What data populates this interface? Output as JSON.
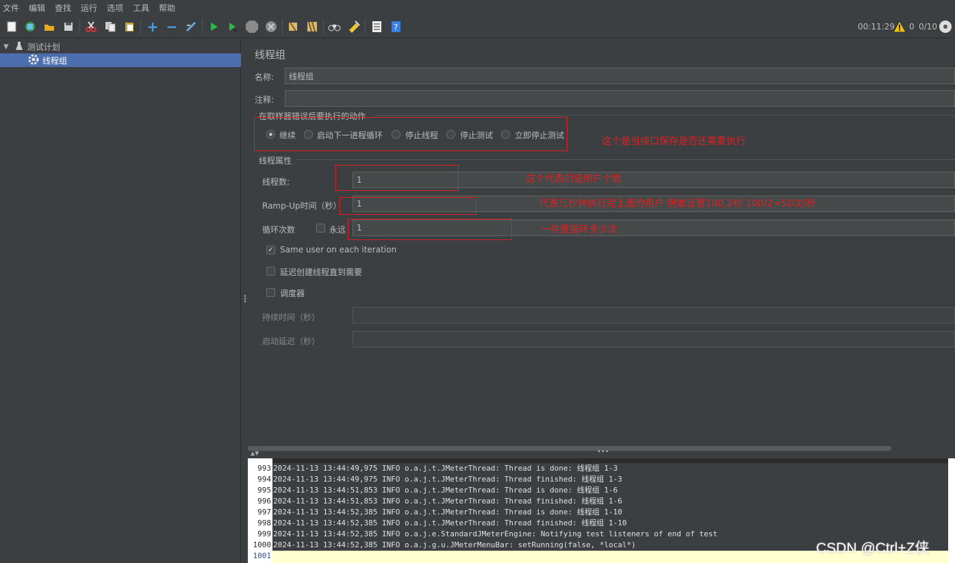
{
  "menu": [
    "文件",
    "编辑",
    "查找",
    "运行",
    "选项",
    "工具",
    "帮助"
  ],
  "toolbar": {
    "timer": "00:11:29",
    "warn_count": "0",
    "threads": "0/10"
  },
  "tree": {
    "root": "测试计划",
    "child": "线程组"
  },
  "panel": {
    "title": "线程组",
    "name_label": "名称:",
    "name_value": "线程组",
    "comment_label": "注释:",
    "comment_value": "",
    "on_error_group": "在取样器错误后要执行的动作",
    "on_error_options": [
      "继续",
      "启动下一进程循环",
      "停止线程",
      "停止测试",
      "立即停止测试"
    ],
    "on_error_selected": "继续",
    "thread_props_group": "线程属性",
    "threads_label": "线程数:",
    "threads_value": "1",
    "rampup_label": "Ramp-Up时间（秒）",
    "rampup_value": "1",
    "loop_label": "循环次数",
    "forever_label": "永远",
    "forever_checked": false,
    "loop_value": "1",
    "same_user_label": "Same user on each iteration",
    "same_user_checked": true,
    "delay_create_label": "延迟创建线程直到需要",
    "delay_create_checked": false,
    "scheduler_label": "调度器",
    "scheduler_checked": false,
    "duration_label": "持续时间（秒）",
    "duration_value": "",
    "startup_delay_label": "启动延迟（秒）",
    "startup_delay_value": ""
  },
  "annotations": {
    "on_error": "这个是当接口保存是否还需要执行",
    "threads": "这个代表的是用户个数",
    "rampup": "代表几秒钟执行完上面的用户 例如设置100,2秒 100/2=50次/秒",
    "loop": "一共要循环多少次"
  },
  "log": [
    {
      "n": "993",
      "t": "2024-11-13 13:44:49,975 INFO o.a.j.t.JMeterThread: Thread is done: 线程组 1-3"
    },
    {
      "n": "994",
      "t": "2024-11-13 13:44:49,975 INFO o.a.j.t.JMeterThread: Thread finished: 线程组 1-3"
    },
    {
      "n": "995",
      "t": "2024-11-13 13:44:51,853 INFO o.a.j.t.JMeterThread: Thread is done: 线程组 1-6"
    },
    {
      "n": "996",
      "t": "2024-11-13 13:44:51,853 INFO o.a.j.t.JMeterThread: Thread finished: 线程组 1-6"
    },
    {
      "n": "997",
      "t": "2024-11-13 13:44:52,385 INFO o.a.j.t.JMeterThread: Thread is done: 线程组 1-10"
    },
    {
      "n": "998",
      "t": "2024-11-13 13:44:52,385 INFO o.a.j.t.JMeterThread: Thread finished: 线程组 1-10"
    },
    {
      "n": "999",
      "t": "2024-11-13 13:44:52,385 INFO o.a.j.e.StandardJMeterEngine: Notifying test listeners of end of test"
    },
    {
      "n": "1000",
      "t": "2024-11-13 13:44:52,385 INFO o.a.j.g.u.JMeterMenuBar: setRunning(false, *local*)"
    },
    {
      "n": "1001",
      "t": ""
    }
  ],
  "watermark": "CSDN @Ctrl+Z侠",
  "colors": {
    "background": "#3c3f41",
    "selection": "#4b6eaf",
    "annotation_red": "#e02020"
  }
}
